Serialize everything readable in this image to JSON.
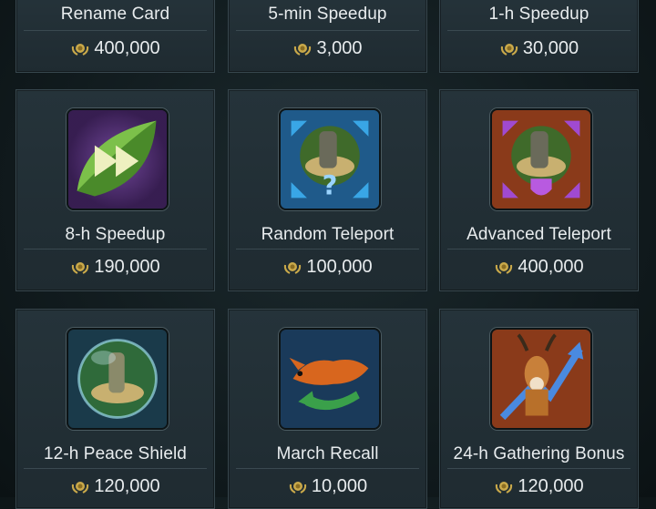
{
  "shop": {
    "items": [
      {
        "name": "Rename Card",
        "price": "400,000",
        "icon": "rename-card-icon"
      },
      {
        "name": "5-min Speedup",
        "price": "3,000",
        "icon": "speedup-icon"
      },
      {
        "name": "1-h Speedup",
        "price": "30,000",
        "icon": "speedup-icon"
      },
      {
        "name": "8-h Speedup",
        "price": "190,000",
        "icon": "fast-forward-leaf-icon"
      },
      {
        "name": "Random Teleport",
        "price": "100,000",
        "icon": "random-teleport-icon"
      },
      {
        "name": "Advanced Teleport",
        "price": "400,000",
        "icon": "advanced-teleport-icon"
      },
      {
        "name": "12-h Peace Shield",
        "price": "120,000",
        "icon": "peace-shield-orb-icon"
      },
      {
        "name": "March Recall",
        "price": "10,000",
        "icon": "march-recall-fox-icon"
      },
      {
        "name": "24-h Gathering Bonus",
        "price": "120,000",
        "icon": "gathering-bonus-antelope-icon"
      }
    ],
    "currency_icon": "laurel-coin-icon",
    "colors": {
      "card_bg": "#25333a",
      "text": "#e8ecee",
      "coin": "#c9a94a"
    }
  }
}
